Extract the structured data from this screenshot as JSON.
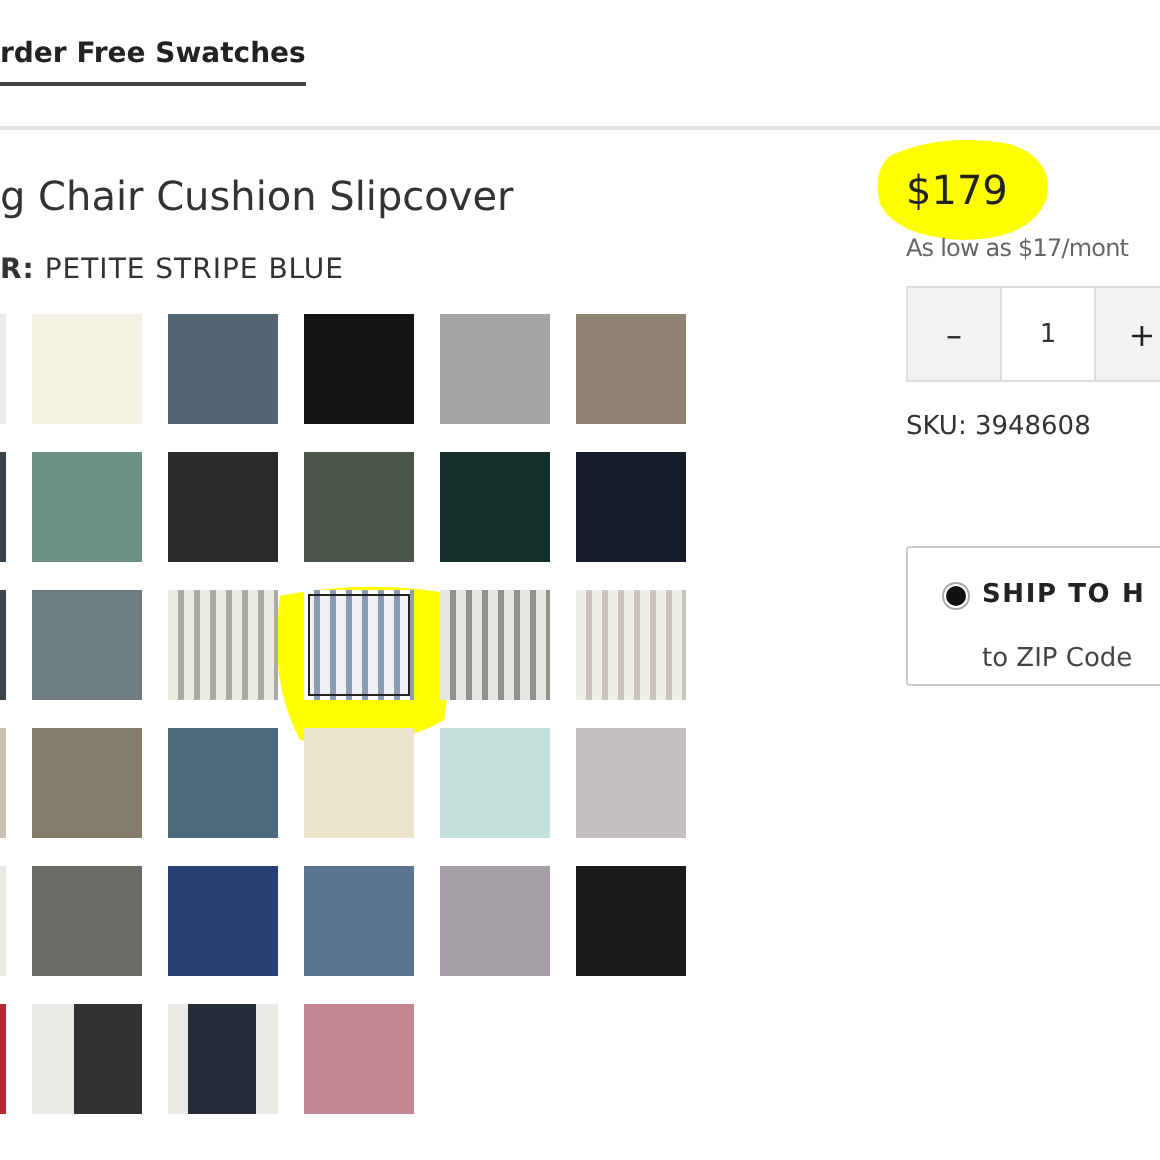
{
  "tabs": [
    {
      "label": "rder Free Swatches",
      "selected": true
    }
  ],
  "product": {
    "title": "g Chair Cushion Slipcover",
    "color_label": "R:",
    "color_value": "PETITE STRIPE BLUE"
  },
  "swatches": [
    {
      "kind": "solid",
      "color": "#ececec",
      "selected": false
    },
    {
      "kind": "solid",
      "color": "#f3efe2",
      "selected": false
    },
    {
      "kind": "solid",
      "color": "#536674",
      "selected": false
    },
    {
      "kind": "solid",
      "color": "#141414",
      "selected": false
    },
    {
      "kind": "solid",
      "color": "#a2a4a5",
      "selected": false
    },
    {
      "kind": "solid",
      "color": "#8e8374",
      "selected": false
    },
    {
      "kind": "solid",
      "color": "#37444e",
      "selected": false
    },
    {
      "kind": "solid",
      "color": "#6b9184",
      "selected": false
    },
    {
      "kind": "solid",
      "color": "#2a2a2a",
      "selected": false
    },
    {
      "kind": "solid",
      "color": "#4a5549",
      "selected": false
    },
    {
      "kind": "solid",
      "color": "#13302d",
      "selected": false
    },
    {
      "kind": "solid",
      "color": "#151d2b",
      "selected": false
    },
    {
      "kind": "solid",
      "color": "#3a4550",
      "selected": false
    },
    {
      "kind": "solid",
      "color": "#6f7d82",
      "selected": false
    },
    {
      "kind": "stripe",
      "color": "#ecebe2",
      "accent": {
        "color": "#a9aba6"
      },
      "selected": false
    },
    {
      "kind": "stripe",
      "color": "#eef0f4",
      "accent": {
        "color": "#8d9ab3"
      },
      "selected": true
    },
    {
      "kind": "stripe",
      "color": "#e6e6e3",
      "accent": {
        "color": "#8f918c"
      },
      "selected": false
    },
    {
      "kind": "stripe",
      "color": "#efeee7",
      "accent": {
        "color": "#c8c6bc"
      },
      "selected": false
    },
    {
      "kind": "solid",
      "color": "#c8c2ae",
      "selected": false
    },
    {
      "kind": "solid",
      "color": "#857c69",
      "selected": false
    },
    {
      "kind": "solid",
      "color": "#4b6a7c",
      "selected": false
    },
    {
      "kind": "solid",
      "color": "#ebe3cb",
      "selected": false
    },
    {
      "kind": "solid",
      "color": "#c6e0dc",
      "selected": false
    },
    {
      "kind": "solid",
      "color": "#c4bfbf",
      "selected": false
    },
    {
      "kind": "solid",
      "color": "#e9e9e5",
      "selected": false
    },
    {
      "kind": "solid",
      "color": "#6a6a66",
      "selected": false
    },
    {
      "kind": "solid",
      "color": "#273f72",
      "selected": false
    },
    {
      "kind": "solid",
      "color": "#5b7590",
      "selected": false
    },
    {
      "kind": "solid",
      "color": "#a39ea4",
      "selected": false
    },
    {
      "kind": "solid",
      "color": "#1b1b19",
      "selected": false
    },
    {
      "kind": "solid",
      "color": "#b52a32",
      "selected": false
    },
    {
      "kind": "block",
      "color": "#323232",
      "accent": {
        "color": "#ebeae6"
      },
      "selected": false
    },
    {
      "kind": "band",
      "color": "#262b38",
      "accent": {
        "color": "#ebeae6"
      },
      "selected": false
    },
    {
      "kind": "solid",
      "color": "#c58694",
      "selected": false
    }
  ],
  "price": "$179",
  "financing": "As low as $17/mont",
  "quantity": {
    "minus": "–",
    "value": "1",
    "plus": "+"
  },
  "sku": "SKU: 3948608",
  "shipping": {
    "selected": true,
    "title": "SHIP TO H",
    "subtitle": "to ZIP Code"
  }
}
